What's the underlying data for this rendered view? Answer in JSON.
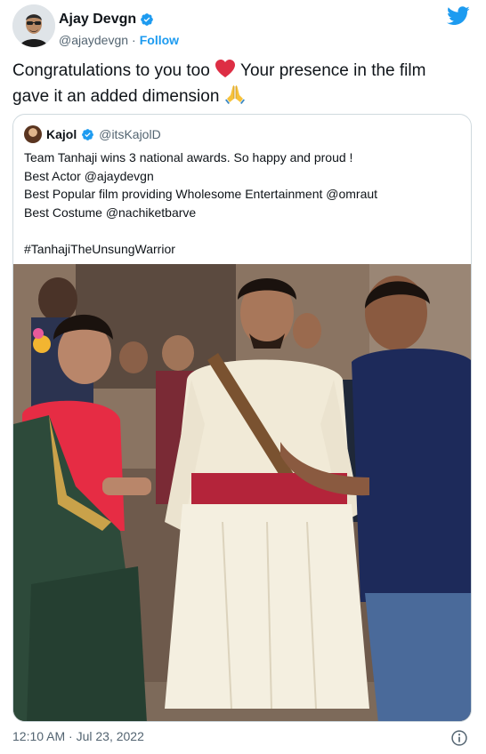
{
  "author": {
    "name": "Ajay Devgn",
    "handle": "@ajaydevgn",
    "separator": "·",
    "follow_label": "Follow"
  },
  "tweet": {
    "line1": "Congratulations to you too",
    "line1_rest": "Your presence in the film",
    "line2": "gave it an added dimension",
    "emoji_heart": "red-heart-emoji",
    "emoji_hands": "folded-hands-emoji"
  },
  "quoted": {
    "name": "Kajol",
    "handle": "@itsKajolD",
    "lines": [
      "Team Tanhaji wins 3 national awards. So happy and proud !",
      "Best Actor @ajaydevgn",
      "Best Popular film providing Wholesome Entertainment @omraut",
      "Best Costume @nachiketbarve",
      "",
      "#TanhajiTheUnsungWarrior"
    ],
    "photo_alt": "photo-attachment"
  },
  "footer": {
    "timestamp": "12:10 AM · Jul 23, 2022"
  },
  "colors": {
    "accent": "#1d9bf0",
    "text": "#0f1419",
    "secondary": "#536471",
    "border": "#cfd9de"
  }
}
